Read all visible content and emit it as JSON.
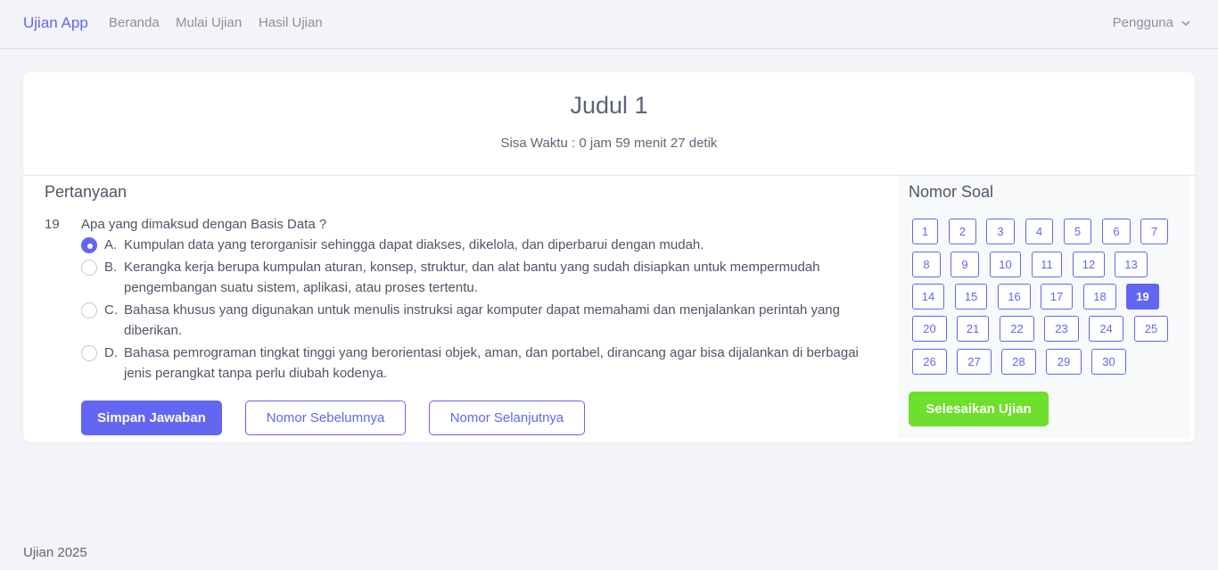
{
  "navbar": {
    "brand": "Ujian App",
    "links": [
      "Beranda",
      "Mulai Ujian",
      "Hasil Ujian"
    ],
    "user": "Pengguna"
  },
  "exam": {
    "title": "Judul 1",
    "timer": "Sisa Waktu : 0 jam 59 menit 27 detik"
  },
  "question": {
    "section_title": "Pertanyaan",
    "number": "19",
    "text": "Apa yang dimaksud dengan Basis Data ?",
    "selected": "A",
    "options": [
      {
        "letter": "A.",
        "text": "Kumpulan data yang terorganisir sehingga dapat diakses, dikelola, dan diperbarui dengan mudah."
      },
      {
        "letter": "B.",
        "text": "Kerangka kerja berupa kumpulan aturan, konsep, struktur, dan alat bantu yang sudah disiapkan untuk mempermudah pengembangan suatu sistem, aplikasi, atau proses tertentu."
      },
      {
        "letter": "C.",
        "text": "Bahasa khusus yang digunakan untuk menulis instruksi agar komputer dapat memahami dan menjalankan perintah yang diberikan."
      },
      {
        "letter": "D.",
        "text": "Bahasa pemrograman tingkat tinggi yang berorientasi objek, aman, dan portabel, dirancang agar bisa dijalankan di berbagai jenis perangkat tanpa perlu diubah kodenya."
      }
    ],
    "buttons": {
      "save": "Simpan Jawaban",
      "prev": "Nomor Sebelumnya",
      "next": "Nomor Selanjutnya"
    }
  },
  "nav_panel": {
    "title": "Nomor Soal",
    "numbers": [
      "1",
      "2",
      "3",
      "4",
      "5",
      "6",
      "7",
      "8",
      "9",
      "10",
      "11",
      "12",
      "13",
      "14",
      "15",
      "16",
      "17",
      "18",
      "19",
      "20",
      "21",
      "22",
      "23",
      "24",
      "25",
      "26",
      "27",
      "28",
      "29",
      "30"
    ],
    "active": "19",
    "finish": "Selesaikan Ujian"
  },
  "footer": "Ujian 2025"
}
